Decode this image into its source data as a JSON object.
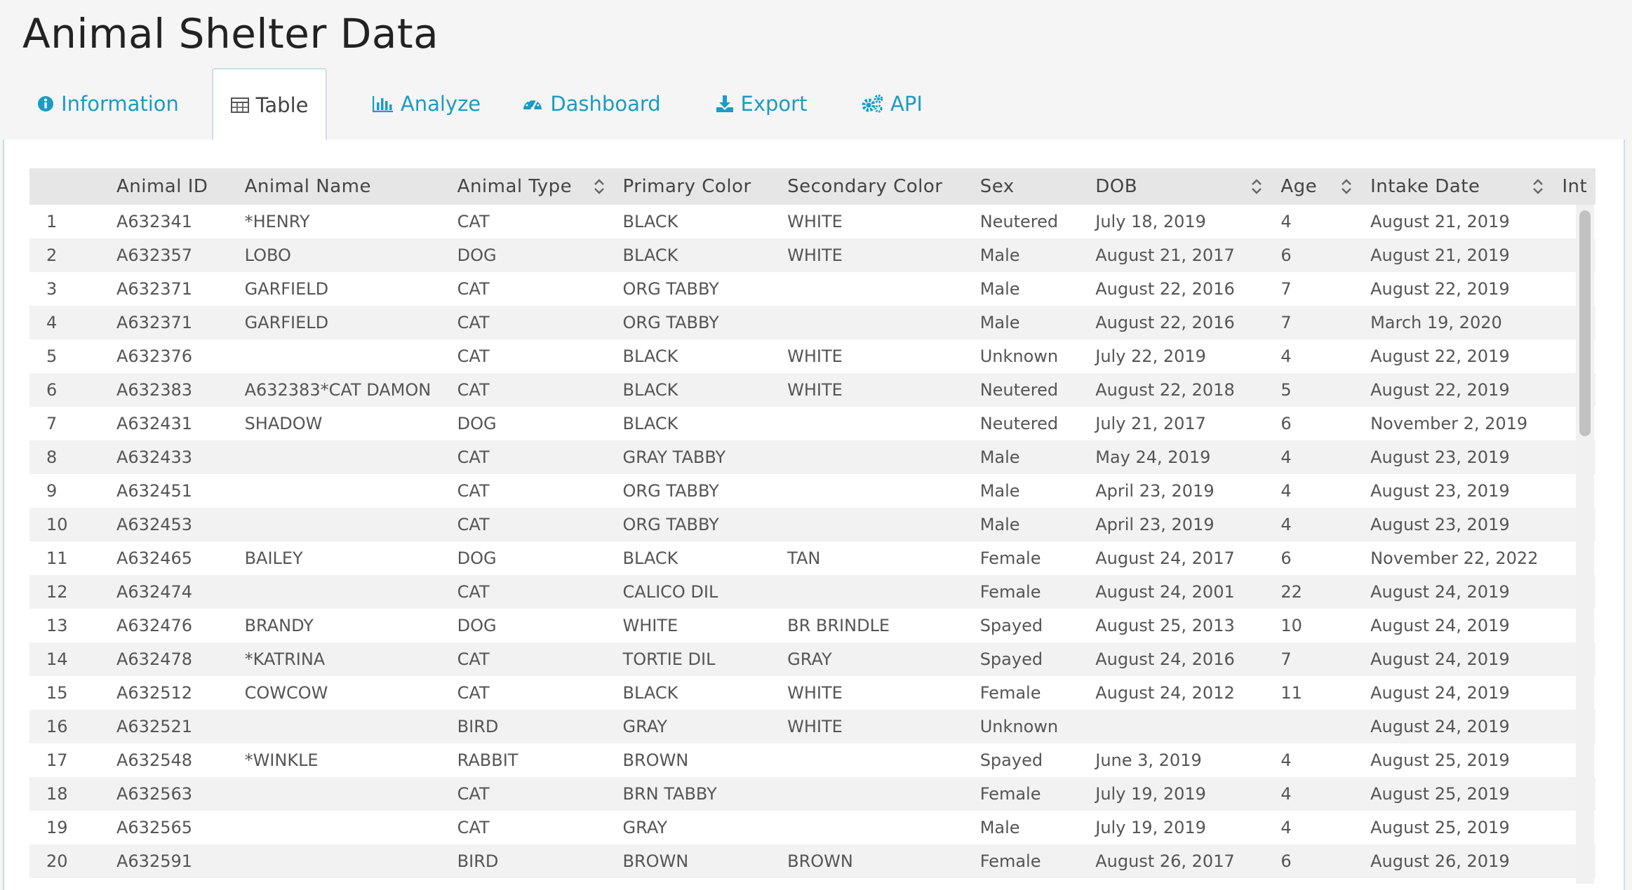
{
  "app": {
    "title": "Animal Shelter Data"
  },
  "tabs": [
    {
      "label": "Information",
      "icon": "info-circle-icon"
    },
    {
      "label": "Table",
      "icon": "table-icon",
      "active": true
    },
    {
      "label": "Analyze",
      "icon": "bar-chart-icon"
    },
    {
      "label": "Dashboard",
      "icon": "tachometer-icon"
    },
    {
      "label": "Export",
      "icon": "download-icon"
    },
    {
      "label": "API",
      "icon": "gears-icon"
    }
  ],
  "table": {
    "headers": [
      "",
      "Animal ID",
      "Animal Name",
      "Animal Type",
      "Primary Color",
      "Secondary Color",
      "Sex",
      "DOB",
      "Age",
      "Intake Date",
      "Int"
    ],
    "rows": [
      [
        "1",
        "A632341",
        "*HENRY",
        "CAT",
        "BLACK",
        "WHITE",
        "Neutered",
        "July 18, 2019",
        "4",
        "August 21, 2019"
      ],
      [
        "2",
        "A632357",
        "LOBO",
        "DOG",
        "BLACK",
        "WHITE",
        "Male",
        "August 21, 2017",
        "6",
        "August 21, 2019"
      ],
      [
        "3",
        "A632371",
        "GARFIELD",
        "CAT",
        "ORG TABBY",
        "",
        "Male",
        "August 22, 2016",
        "7",
        "August 22, 2019"
      ],
      [
        "4",
        "A632371",
        "GARFIELD",
        "CAT",
        "ORG TABBY",
        "",
        "Male",
        "August 22, 2016",
        "7",
        "March 19, 2020"
      ],
      [
        "5",
        "A632376",
        "",
        "CAT",
        "BLACK",
        "WHITE",
        "Unknown",
        "July 22, 2019",
        "4",
        "August 22, 2019"
      ],
      [
        "6",
        "A632383",
        "A632383*CAT DAMON",
        "CAT",
        "BLACK",
        "WHITE",
        "Neutered",
        "August 22, 2018",
        "5",
        "August 22, 2019"
      ],
      [
        "7",
        "A632431",
        "SHADOW",
        "DOG",
        "BLACK",
        "",
        "Neutered",
        "July 21, 2017",
        "6",
        "November 2, 2019"
      ],
      [
        "8",
        "A632433",
        "",
        "CAT",
        "GRAY TABBY",
        "",
        "Male",
        "May 24, 2019",
        "4",
        "August 23, 2019"
      ],
      [
        "9",
        "A632451",
        "",
        "CAT",
        "ORG TABBY",
        "",
        "Male",
        "April 23, 2019",
        "4",
        "August 23, 2019"
      ],
      [
        "10",
        "A632453",
        "",
        "CAT",
        "ORG TABBY",
        "",
        "Male",
        "April 23, 2019",
        "4",
        "August 23, 2019"
      ],
      [
        "11",
        "A632465",
        "BAILEY",
        "DOG",
        "BLACK",
        "TAN",
        "Female",
        "August 24, 2017",
        "6",
        "November 22, 2022"
      ],
      [
        "12",
        "A632474",
        "",
        "CAT",
        "CALICO DIL",
        "",
        "Female",
        "August 24, 2001",
        "22",
        "August 24, 2019"
      ],
      [
        "13",
        "A632476",
        "BRANDY",
        "DOG",
        "WHITE",
        "BR BRINDLE",
        "Spayed",
        "August 25, 2013",
        "10",
        "August 24, 2019"
      ],
      [
        "14",
        "A632478",
        "*KATRINA",
        "CAT",
        "TORTIE DIL",
        "GRAY",
        "Spayed",
        "August 24, 2016",
        "7",
        "August 24, 2019"
      ],
      [
        "15",
        "A632512",
        "COWCOW",
        "CAT",
        "BLACK",
        "WHITE",
        "Female",
        "August 24, 2012",
        "11",
        "August 24, 2019"
      ],
      [
        "16",
        "A632521",
        "",
        "BIRD",
        "GRAY",
        "WHITE",
        "Unknown",
        "",
        "",
        "August 24, 2019"
      ],
      [
        "17",
        "A632548",
        "*WINKLE",
        "RABBIT",
        "BROWN",
        "",
        "Spayed",
        "June 3, 2019",
        "4",
        "August 25, 2019"
      ],
      [
        "18",
        "A632563",
        "",
        "CAT",
        "BRN TABBY",
        "",
        "Female",
        "July 19, 2019",
        "4",
        "August 25, 2019"
      ],
      [
        "19",
        "A632565",
        "",
        "CAT",
        "GRAY",
        "",
        "Male",
        "July 19, 2019",
        "4",
        "August 25, 2019"
      ],
      [
        "20",
        "A632591",
        "",
        "BIRD",
        "BROWN",
        "BROWN",
        "Female",
        "August 26, 2017",
        "6",
        "August 26, 2019"
      ]
    ]
  }
}
